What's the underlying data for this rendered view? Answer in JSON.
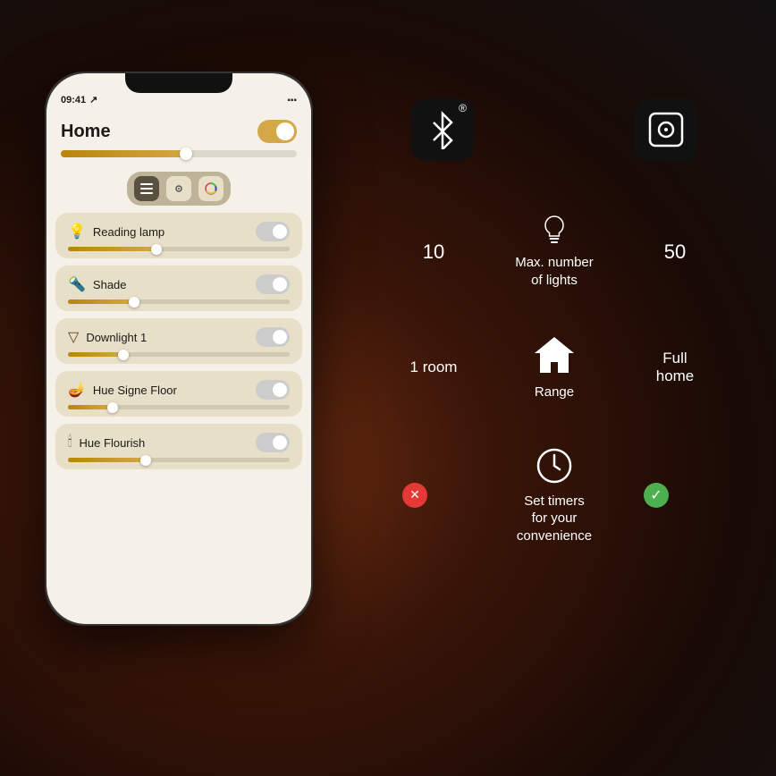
{
  "background": {
    "description": "Dark brown/amber radial gradient background"
  },
  "phone": {
    "status_time": "09:41",
    "home_title": "Home",
    "lights": [
      {
        "name": "Reading lamp",
        "slider_pct": 40,
        "on": false
      },
      {
        "name": "Shade",
        "slider_pct": 30,
        "on": false
      },
      {
        "name": "Downlight 1",
        "slider_pct": 25,
        "on": false
      },
      {
        "name": "Hue Signe Floor",
        "slider_pct": 20,
        "on": false
      },
      {
        "name": "Hue Flourish",
        "slider_pct": 35,
        "on": false
      }
    ]
  },
  "info_panel": {
    "bluetooth_label": "Bluetooth",
    "hub_label": "Hub",
    "max_lights": {
      "min_value": "10",
      "label_line1": "Max. number",
      "label_line2": "of lights",
      "max_value": "50"
    },
    "range": {
      "min_value": "1 room",
      "label": "Range",
      "max_value": "Full home"
    },
    "timers": {
      "label_line1": "Set timers",
      "label_line2": "for your",
      "label_line3": "convenience",
      "no_label": "No",
      "yes_label": "Yes"
    }
  }
}
